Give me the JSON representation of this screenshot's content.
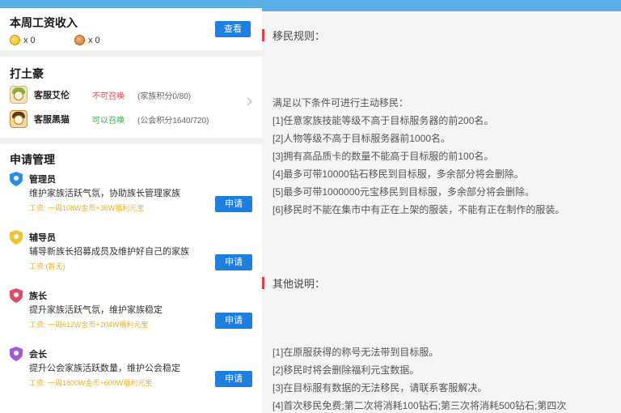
{
  "wage": {
    "title": "本周工资收入",
    "gold_count": "x 0",
    "copper_count": "x 0",
    "view_label": "查看"
  },
  "tuhao": {
    "title": "打土豪",
    "rows": [
      {
        "name": "客服艾伦",
        "status": "不可召唤",
        "score": "(家族积分0/80)"
      },
      {
        "name": "客服黑猫",
        "status": "可以召唤",
        "score": "(公会积分1640/720)"
      }
    ]
  },
  "apply": {
    "title": "申请管理",
    "roles": [
      {
        "name": "管理员",
        "desc": "维护家族活跃气氛，协助族长管理家族",
        "wage": "工资: 一周108W金币+36W福利元宝",
        "button": "申请",
        "color": "#2b8de8"
      },
      {
        "name": "辅导员",
        "desc": "辅导新族长招募成员及维护好自己的家族",
        "wage": "工资:(暂无)",
        "button": "申请",
        "color": "#f2c230"
      },
      {
        "name": "族长",
        "desc": "提升家族活跃气氛，维护家族稳定",
        "wage": "工资: 一周612W金币+204W福利元宝",
        "button": "申请",
        "color": "#e04a6a"
      },
      {
        "name": "会长",
        "desc": "提升公会家族活跃数量，维护公会稳定",
        "wage": "工资: 一周1800W金币+600W福利元宝",
        "button": "申请",
        "color": "#a35ad8"
      }
    ]
  },
  "rules": {
    "migration_heading": "移民规则：",
    "migration_intro": "满足以下条件可进行主动移民：",
    "migration_items": [
      "[1]任意家族技能等级不高于目标服务器的前200名。",
      "[2]人物等级不高于目标服务器前1000名。",
      "[3]拥有高品质卡的数量不能高于目标服的前100名。",
      "[4]最多可带10000钻石移民到目标服，多余部分将会删除。",
      "[5]最多可带1000000元宝移民到目标服，多余部分将会删除。",
      "[6]移民时不能在集市中有正在上架的服装，不能有正在制作的服装。"
    ],
    "other_heading": "其他说明：",
    "other_items": [
      "[1]在原服获得的称号无法带到目标服。",
      "[2]移民时将会删除福利元宝数据。",
      "[3]在目标服有数据的无法移民，请联系客服解决。",
      "[4]首次移民免费;第二次将消耗100钻石;第三次将消耗500钻石;第四次"
    ]
  },
  "colors": {
    "accent": "#1f7ee0",
    "heading_bar": "#e04040",
    "top_bar": "#5aaee8"
  }
}
